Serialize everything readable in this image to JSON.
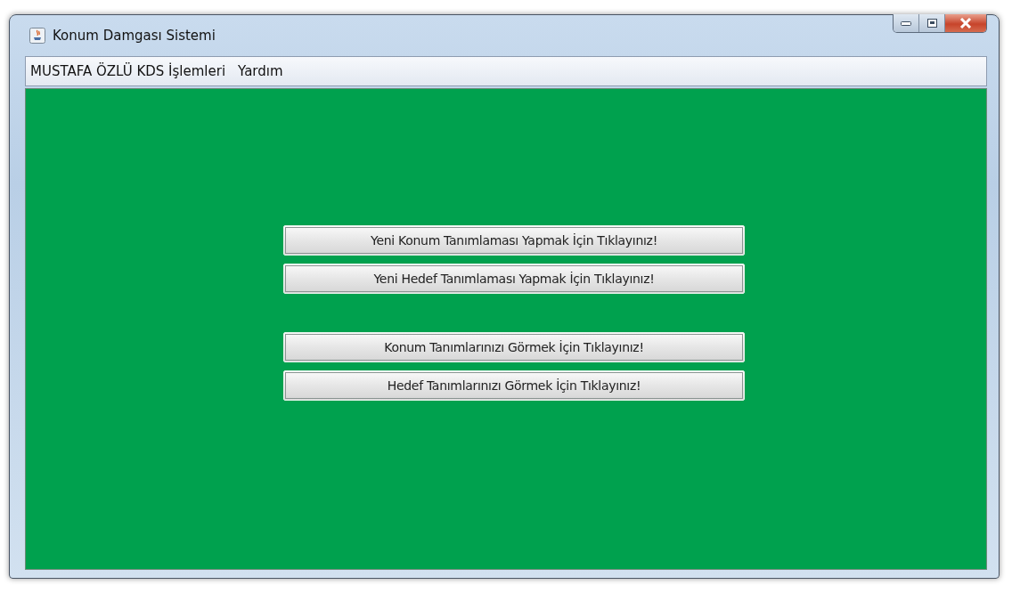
{
  "window": {
    "title": "Konum Damgası Sistemi"
  },
  "menu": [
    "MUSTAFA ÖZLÜ KDS İşlemleri",
    "Yardım"
  ],
  "button_groups": [
    [
      "Yeni Konum Tanımlaması Yapmak İçin Tıklayınız!",
      "Yeni Hedef Tanımlaması Yapmak İçin Tıklayınız!"
    ],
    [
      "Konum Tanımlarınızı Görmek İçin Tıklayınız!",
      "Hedef Tanımlarınızı Görmek İçin Tıklayınız!"
    ]
  ]
}
